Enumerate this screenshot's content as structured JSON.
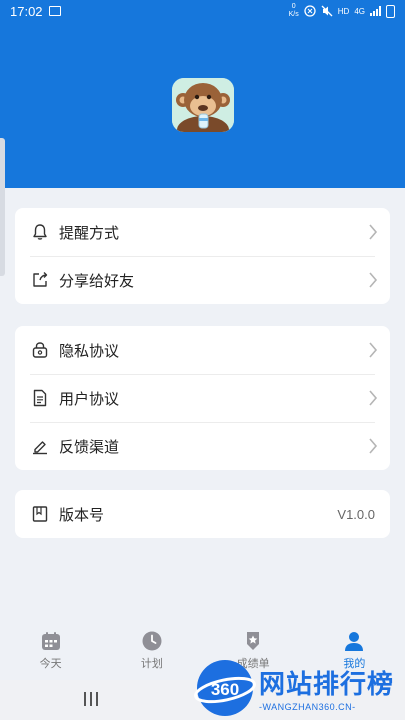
{
  "status_bar": {
    "time": "17:02",
    "speed": "0\nK/s",
    "hd": "HD",
    "net": "4G"
  },
  "header": {
    "bg_color": "#1677dc",
    "avatar_icon": "monkey-avatar"
  },
  "cards": [
    {
      "items": [
        {
          "icon": "bell-icon",
          "label": "提醒方式"
        },
        {
          "icon": "share-icon",
          "label": "分享给好友"
        }
      ]
    },
    {
      "items": [
        {
          "icon": "lock-icon",
          "label": "隐私协议"
        },
        {
          "icon": "document-icon",
          "label": "用户协议"
        },
        {
          "icon": "edit-icon",
          "label": "反馈渠道"
        }
      ]
    },
    {
      "items": [
        {
          "icon": "book-icon",
          "label": "版本号",
          "value": "V1.0.0"
        }
      ]
    }
  ],
  "tabbar": {
    "tabs": [
      {
        "icon": "calendar-icon",
        "label": "今天",
        "active": false
      },
      {
        "icon": "clock-icon",
        "label": "计划",
        "active": false
      },
      {
        "icon": "medal-icon",
        "label": "成绩单",
        "active": false
      },
      {
        "icon": "user-icon",
        "label": "我的",
        "active": true
      }
    ],
    "active_color": "#1677dc"
  },
  "watermark": {
    "badge": "360",
    "title": "网站排行榜",
    "subtitle": "-WANGZHAN360.CN-"
  }
}
